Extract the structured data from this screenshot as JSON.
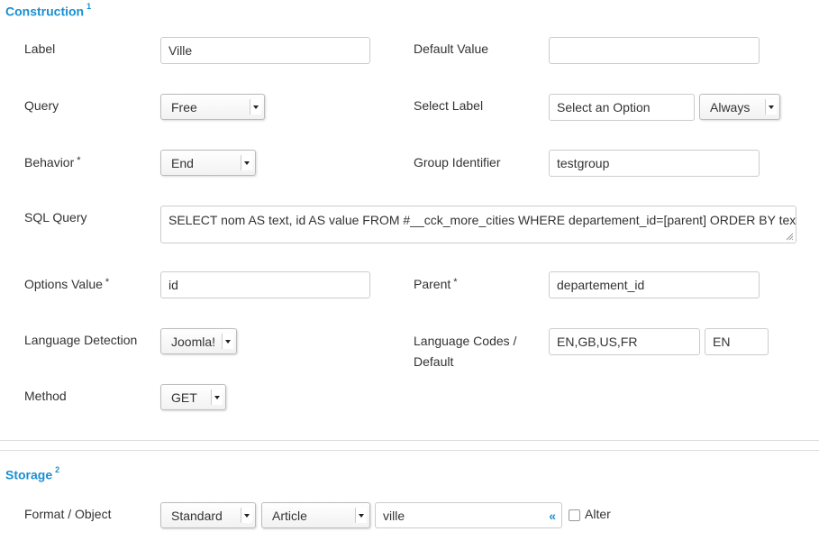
{
  "construction": {
    "title": "Construction",
    "marker": "1",
    "fields": {
      "label": {
        "label": "Label",
        "value": "Ville"
      },
      "default_value": {
        "label": "Default Value",
        "value": ""
      },
      "query": {
        "label": "Query",
        "value": "Free"
      },
      "select_label": {
        "label": "Select Label",
        "value": "Select an Option",
        "mode": "Always"
      },
      "behavior": {
        "label": "Behavior",
        "required_mark": "*",
        "value": "End"
      },
      "group_identifier": {
        "label": "Group Identifier",
        "value": "testgroup"
      },
      "sql_query": {
        "label": "SQL Query",
        "value": "SELECT nom AS text, id AS value FROM #__cck_more_cities WHERE departement_id=[parent] ORDER BY text"
      },
      "options_value": {
        "label": "Options Value",
        "required_mark": "*",
        "value": "id"
      },
      "parent": {
        "label": "Parent",
        "required_mark": "*",
        "value": "departement_id"
      },
      "language_detection": {
        "label": "Language Detection",
        "value": "Joomla!"
      },
      "language_codes": {
        "label_line1": "Language Codes /",
        "label_line2": "Default",
        "codes": "EN,GB,US,FR",
        "default": "EN"
      },
      "method": {
        "label": "Method",
        "value": "GET"
      }
    }
  },
  "storage": {
    "title": "Storage",
    "marker": "2",
    "format_object": {
      "label": "Format / Object",
      "format": "Standard",
      "object": "Article",
      "field": "ville",
      "field_icon": "«",
      "alter_label": "Alter",
      "alter_checked": false
    }
  }
}
